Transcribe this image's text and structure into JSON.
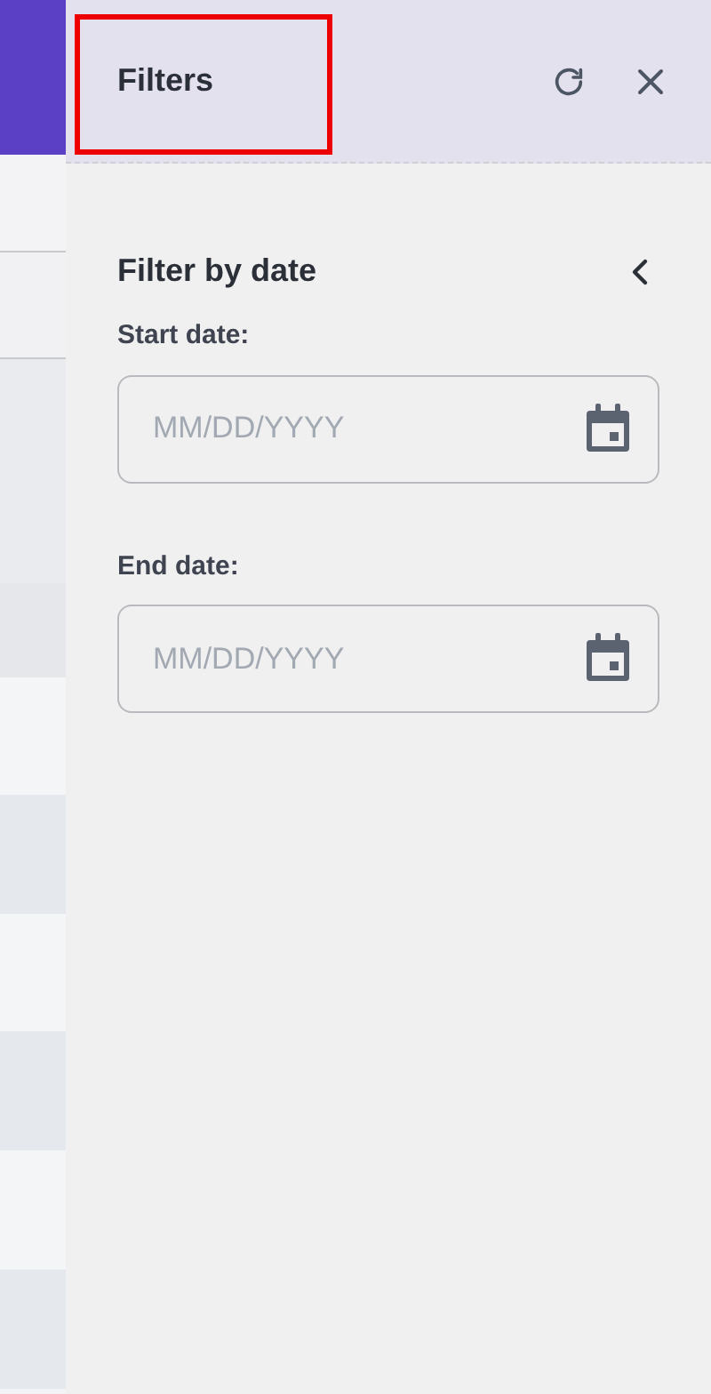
{
  "panel": {
    "title": "Filters",
    "title_highlighted": true
  },
  "section": {
    "title": "Filter by date",
    "expanded": true
  },
  "fields": [
    {
      "label": "Start date:",
      "placeholder": "MM/DD/YYYY"
    },
    {
      "label": "End date:",
      "placeholder": "MM/DD/YYYY"
    }
  ]
}
